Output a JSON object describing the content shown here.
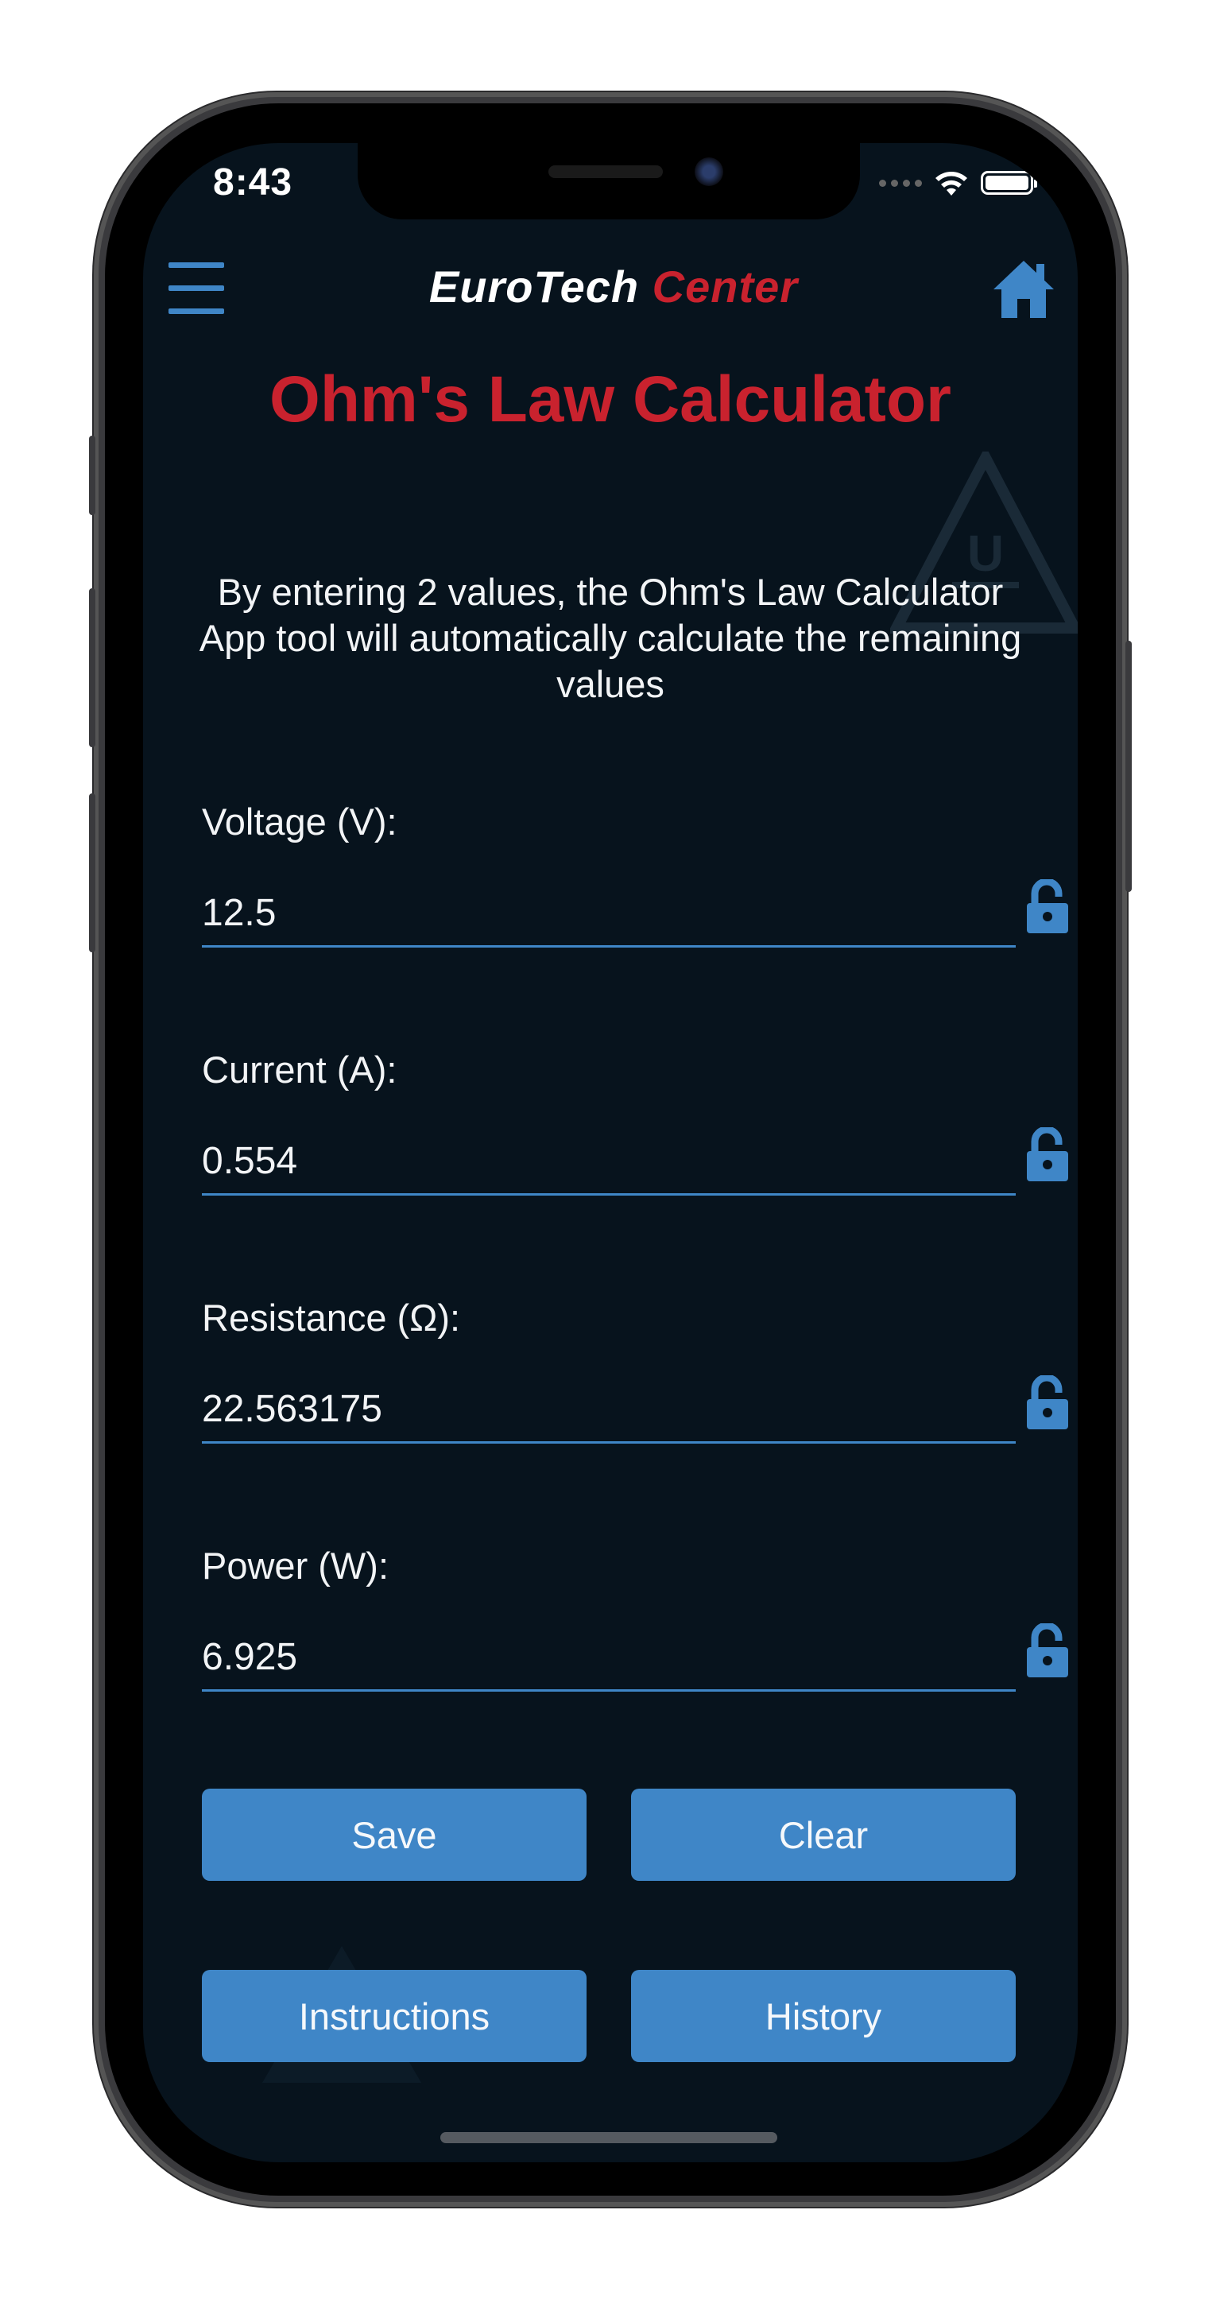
{
  "status_bar": {
    "time": "8:43"
  },
  "header": {
    "brand_part1": "EuroTech",
    "brand_part2": "Center",
    "menu_icon": "hamburger-menu-icon",
    "home_icon": "home-icon"
  },
  "main": {
    "title": "Ohm's Law Calculator",
    "description": "By entering 2 values, the Ohm's Law Calculator App tool will automatically calculate the remaining values",
    "fields": [
      {
        "label": "Voltage (V):",
        "value": "12.5",
        "lock_icon": "unlocked-padlock-icon"
      },
      {
        "label": "Current (A):",
        "value": "0.554",
        "lock_icon": "unlocked-padlock-icon"
      },
      {
        "label": "Resistance (Ω):",
        "value": "22.563175",
        "lock_icon": "unlocked-padlock-icon"
      },
      {
        "label": "Power (W):",
        "value": "6.925",
        "lock_icon": "unlocked-padlock-icon"
      }
    ],
    "buttons": {
      "save": "Save",
      "clear": "Clear",
      "instructions": "Instructions",
      "history": "History"
    }
  },
  "colors": {
    "background": "#07131d",
    "accent_blue": "#3f86c7",
    "brand_red": "#c9222e",
    "text": "#f2f4f6"
  }
}
